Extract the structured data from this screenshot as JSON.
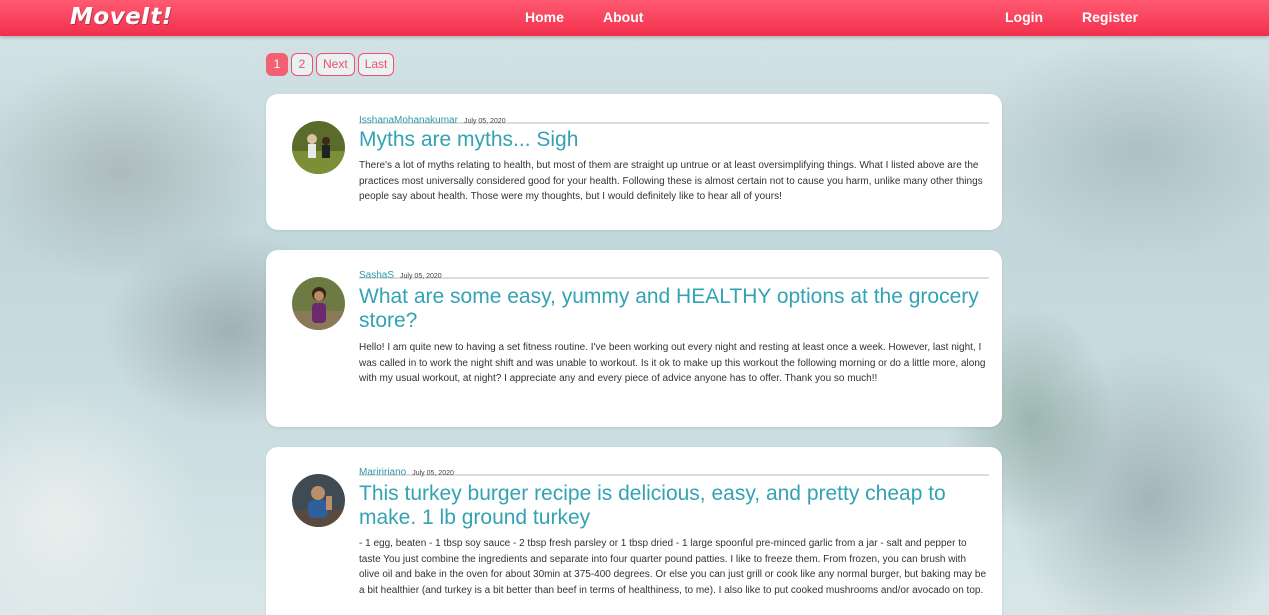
{
  "nav": {
    "logo": "MoveIt!",
    "home": "Home",
    "about": "About",
    "login": "Login",
    "register": "Register"
  },
  "pagination": {
    "current": "1",
    "page2": "2",
    "next": "Next",
    "last": "Last"
  },
  "posts": [
    {
      "author": "IsshanaMohanakumar",
      "date": "July 05, 2020",
      "title": "Myths are myths... Sigh",
      "body": "There's a lot of myths relating to health, but most of them are straight up untrue or at least oversimplifying things. What I listed above are the practices most universally considered good for your health. Following these is almost certain not to cause you harm, unlike many other things people say about health. Those were my thoughts, but I would definitely like to hear all of yours!"
    },
    {
      "author": "SashaS",
      "date": "July 05, 2020",
      "title": "What are some easy, yummy and HEALTHY options at the grocery store?",
      "body": "Hello! I am quite new to having a set fitness routine. I've been working out every night and resting at least once a week. However, last night, I was called in to work the night shift and was unable to workout. Is it ok to make up this workout the following morning or do a little more, along with my usual workout, at night? I appreciate any and every piece of advice anyone has to offer. Thank you so much!!"
    },
    {
      "author": "Mariririano",
      "date": "July 05, 2020",
      "title": "This turkey burger recipe is delicious, easy, and pretty cheap to make. 1 lb ground turkey",
      "body": "- 1 egg, beaten - 1 tbsp soy sauce - 2 tbsp fresh parsley or 1 tbsp dried - 1 large spoonful pre-minced garlic from a jar - salt and pepper to taste You just combine the ingredients and separate into four quarter pound patties. I like to freeze them. From frozen, you can brush with olive oil and bake in the oven for about 30min at 375-400 degrees. Or else you can just grill or cook like any normal burger, but baking may be a bit healthier (and turkey is a bit better than beef in terms of healthiness, to me). I also like to put cooked mushrooms and/or avocado on top."
    }
  ],
  "colors": {
    "nav": "#f22f4c",
    "accent": "#33a3b3",
    "pager": "#f0506a"
  }
}
